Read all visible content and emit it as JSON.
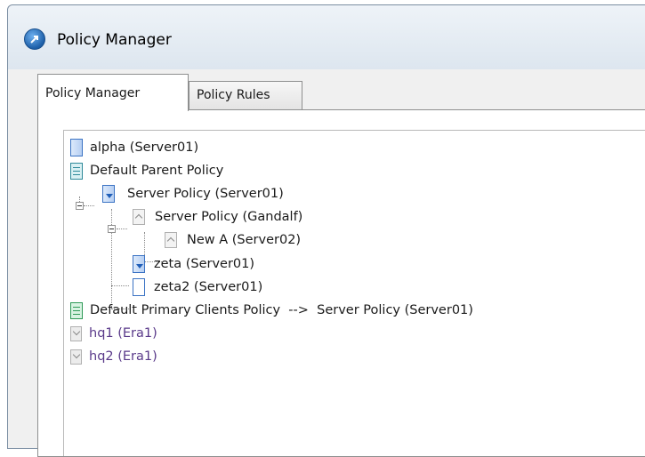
{
  "window": {
    "title": "Policy Manager",
    "app_icon": "policy-manager-app-icon"
  },
  "tabs": [
    {
      "label": "Policy Manager",
      "active": true
    },
    {
      "label": "Policy Rules",
      "active": false
    }
  ],
  "tree": [
    {
      "label": "alpha (Server01)",
      "icon": "policy-doc-blue-icon"
    },
    {
      "label": "Default Parent Policy",
      "icon": "policy-doc-parent-icon"
    },
    {
      "label": "Server Policy (Server01)",
      "icon": "policy-doc-down-arrow-icon",
      "expanded": true
    },
    {
      "label": "Server Policy (Gandalf)",
      "icon": "policy-doc-up-grey-icon",
      "expanded": true
    },
    {
      "label": "New A (Server02)",
      "icon": "policy-doc-up-grey-icon"
    },
    {
      "label": "zeta (Server01)",
      "icon": "policy-doc-down-arrow-icon"
    },
    {
      "label": "zeta2 (Server01)",
      "icon": "policy-doc-outline-icon"
    },
    {
      "label": "Default Primary Clients Policy  -->  Server Policy (Server01)",
      "icon": "policy-doc-green-icon"
    },
    {
      "label": "hq1 (Era1)",
      "icon": "policy-doc-down-grey-icon",
      "disabled": true
    },
    {
      "label": "hq2 (Era1)",
      "icon": "policy-doc-down-grey-icon",
      "disabled": true
    }
  ]
}
